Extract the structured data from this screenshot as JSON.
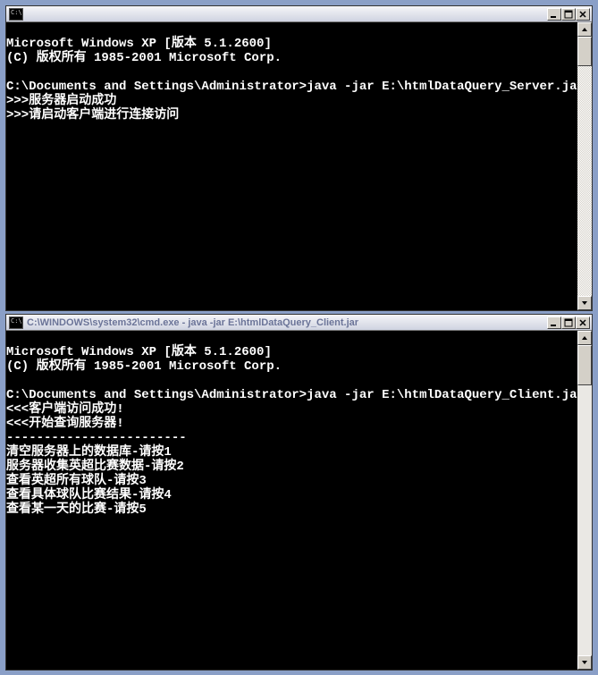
{
  "window1": {
    "title": "",
    "lines": [
      "Microsoft Windows XP [版本 5.1.2600]",
      "(C) 版权所有 1985-2001 Microsoft Corp.",
      "",
      "C:\\Documents and Settings\\Administrator>java -jar E:\\htmlDataQuery_Server.jar",
      ">>>服务器启动成功",
      ">>>请启动客户端进行连接访问"
    ]
  },
  "window2": {
    "title": "C:\\WINDOWS\\system32\\cmd.exe - java -jar E:\\htmlDataQuery_Client.jar",
    "lines": [
      "Microsoft Windows XP [版本 5.1.2600]",
      "(C) 版权所有 1985-2001 Microsoft Corp.",
      "",
      "C:\\Documents and Settings\\Administrator>java -jar E:\\htmlDataQuery_Client.jar",
      "<<<客户端访问成功!",
      "<<<开始查询服务器!",
      "------------------------",
      "清空服务器上的数据库-请按1",
      "服务器收集英超比赛数据-请按2",
      "查看英超所有球队-请按3",
      "查看具体球队比赛结果-请按4",
      "查看某一天的比赛-请按5"
    ]
  }
}
